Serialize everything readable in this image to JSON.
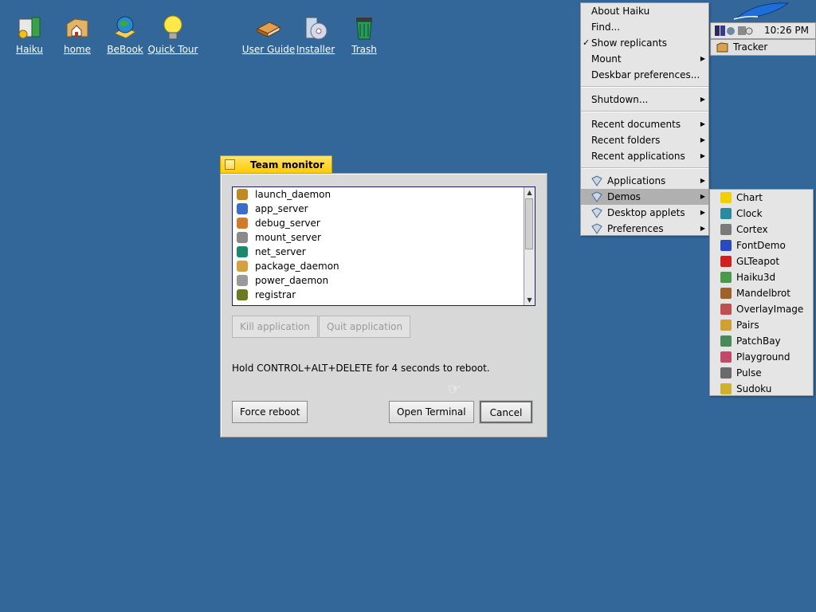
{
  "desktop": {
    "icons": [
      {
        "label": "Haiku"
      },
      {
        "label": "home"
      },
      {
        "label": "BeBook"
      },
      {
        "label": "Quick Tour"
      },
      {
        "label": "User Guide"
      },
      {
        "label": "Installer"
      },
      {
        "label": "Trash"
      }
    ]
  },
  "team_monitor": {
    "title": "Team monitor",
    "processes": [
      {
        "name": "launch_daemon",
        "color": "#c08a20"
      },
      {
        "name": "app_server",
        "color": "#3a6ec8"
      },
      {
        "name": "debug_server",
        "color": "#d07a2a"
      },
      {
        "name": "mount_server",
        "color": "#8a8a8a"
      },
      {
        "name": "net_server",
        "color": "#1a8a6a"
      },
      {
        "name": "package_daemon",
        "color": "#d4a040"
      },
      {
        "name": "power_daemon",
        "color": "#9a9a9a"
      },
      {
        "name": "registrar",
        "color": "#6a7a20"
      }
    ],
    "kill_label": "Kill application",
    "quit_label": "Quit application",
    "hint": "Hold CONTROL+ALT+DELETE for 4 seconds to reboot.",
    "force_reboot_label": "Force reboot",
    "open_terminal_label": "Open Terminal",
    "cancel_label": "Cancel"
  },
  "deskbar_menu": {
    "items": [
      {
        "label": "About Haiku"
      },
      {
        "label": "Find..."
      },
      {
        "label": "Show replicants",
        "checked": true
      },
      {
        "label": "Mount"
      },
      {
        "label": "Deskbar preferences..."
      },
      {
        "label": "Shutdown..."
      },
      {
        "label": "Recent documents"
      },
      {
        "label": "Recent folders"
      },
      {
        "label": "Recent applications"
      },
      {
        "label": "Applications"
      },
      {
        "label": "Demos"
      },
      {
        "label": "Desktop applets"
      },
      {
        "label": "Preferences"
      }
    ],
    "check_mark": "✓"
  },
  "deskbar": {
    "clock": "10:26 PM",
    "tracker_label": "Tracker"
  },
  "demos_submenu": {
    "items": [
      {
        "label": "Chart",
        "color": "#f0d000"
      },
      {
        "label": "Clock",
        "color": "#2a8aa0"
      },
      {
        "label": "Cortex",
        "color": "#7a7a7a"
      },
      {
        "label": "FontDemo",
        "color": "#2a4ac0"
      },
      {
        "label": "GLTeapot",
        "color": "#d02020"
      },
      {
        "label": "Haiku3d",
        "color": "#4a9a4a"
      },
      {
        "label": "Mandelbrot",
        "color": "#a0602a"
      },
      {
        "label": "OverlayImage",
        "color": "#c05050"
      },
      {
        "label": "Pairs",
        "color": "#d0a030"
      },
      {
        "label": "PatchBay",
        "color": "#4a8a5a"
      },
      {
        "label": "Playground",
        "color": "#c04a6a"
      },
      {
        "label": "Pulse",
        "color": "#6a6a6a"
      },
      {
        "label": "Sudoku",
        "color": "#d0b030"
      }
    ]
  },
  "colors": {
    "desktop": "#336699",
    "tab": "#ffcb00"
  }
}
